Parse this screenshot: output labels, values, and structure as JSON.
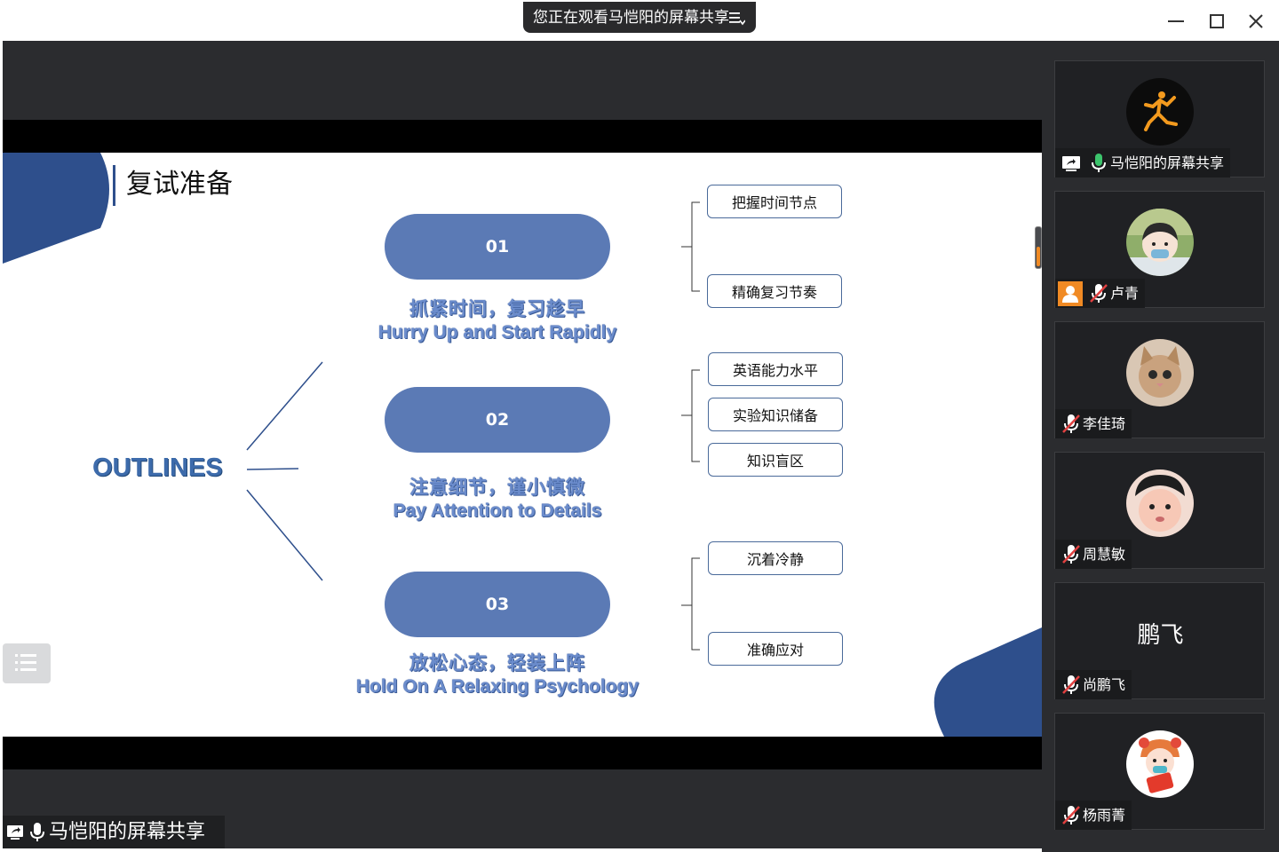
{
  "banner": {
    "text": "您正在观看马恺阳的屏幕共享"
  },
  "window_controls": [
    "minimize-icon",
    "maximize-icon",
    "close-icon"
  ],
  "slide": {
    "title": "复试准备",
    "hub_label": "OUTLINES",
    "sections": [
      {
        "number": "01",
        "cn": "抓紧时间，复习趁早",
        "en": "Hurry Up and Start Rapidly",
        "items": [
          "把握时间节点",
          "精确复习节奏"
        ]
      },
      {
        "number": "02",
        "cn": "注意细节，谨小慎微",
        "en": "Pay Attention to Details",
        "items": [
          "英语能力水平",
          "实验知识储备",
          "知识盲区"
        ]
      },
      {
        "number": "03",
        "cn": "放松心态，轻装上阵",
        "en": "Hold On A Relaxing Psychology",
        "items": [
          "沉着冷静",
          "准确应对"
        ]
      }
    ]
  },
  "presenter_label": "马恺阳的屏幕共享",
  "participants": [
    {
      "name": "马恺阳的屏幕共享",
      "mic": "on",
      "avatar": "jumpman-logo-avatar",
      "extra_icon": "screen-share-icon"
    },
    {
      "name": "卢青",
      "mic": "muted",
      "avatar": "cartoon-face-avatar",
      "extra_icon": "host-person-icon"
    },
    {
      "name": "李佳琦",
      "mic": "muted",
      "avatar": "kitten-avatar"
    },
    {
      "name": "周慧敏",
      "mic": "muted",
      "avatar": "child-face-avatar"
    },
    {
      "name": "尚鹏飞",
      "mic": "muted",
      "display_text": "鹏飞"
    },
    {
      "name": "杨雨菁",
      "mic": "muted",
      "avatar": "cartoon-girl-avatar"
    }
  ],
  "colors": {
    "accent_blue": "#2e4f8c",
    "pill_blue": "#5b7ab5",
    "mic_green": "#3cc46c",
    "host_orange": "#f08a24"
  }
}
